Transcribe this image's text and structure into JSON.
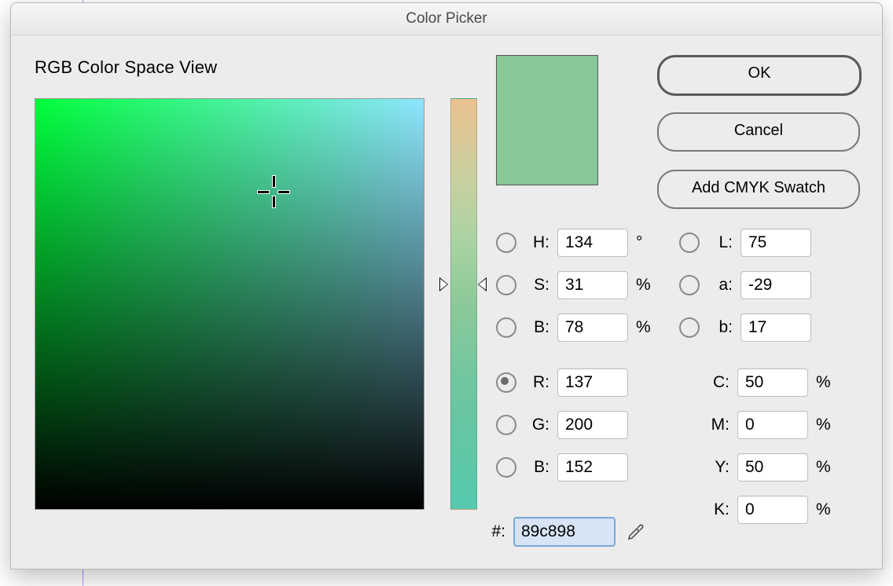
{
  "window": {
    "title": "Color Picker"
  },
  "view_label": "RGB Color Space View",
  "swatch_color": "#89c898",
  "buttons": {
    "ok": "OK",
    "cancel": "Cancel",
    "add_swatch": "Add CMYK Swatch"
  },
  "hsb": {
    "h": {
      "label": "H:",
      "value": "134",
      "unit": "°"
    },
    "s": {
      "label": "S:",
      "value": "31",
      "unit": "%"
    },
    "b": {
      "label": "B:",
      "value": "78",
      "unit": "%"
    }
  },
  "rgb": {
    "r": {
      "label": "R:",
      "value": "137"
    },
    "g": {
      "label": "G:",
      "value": "200"
    },
    "b": {
      "label": "B:",
      "value": "152"
    }
  },
  "lab": {
    "l": {
      "label": "L:",
      "value": "75"
    },
    "a": {
      "label": "a:",
      "value": "-29"
    },
    "b": {
      "label": "b:",
      "value": "17"
    }
  },
  "cmyk": {
    "c": {
      "label": "C:",
      "value": "50",
      "unit": "%"
    },
    "m": {
      "label": "M:",
      "value": "0",
      "unit": "%"
    },
    "y": {
      "label": "Y:",
      "value": "50",
      "unit": "%"
    },
    "k": {
      "label": "K:",
      "value": "0",
      "unit": "%"
    }
  },
  "hex": {
    "label": "#:",
    "value": "89c898"
  },
  "selected_radio": "R"
}
